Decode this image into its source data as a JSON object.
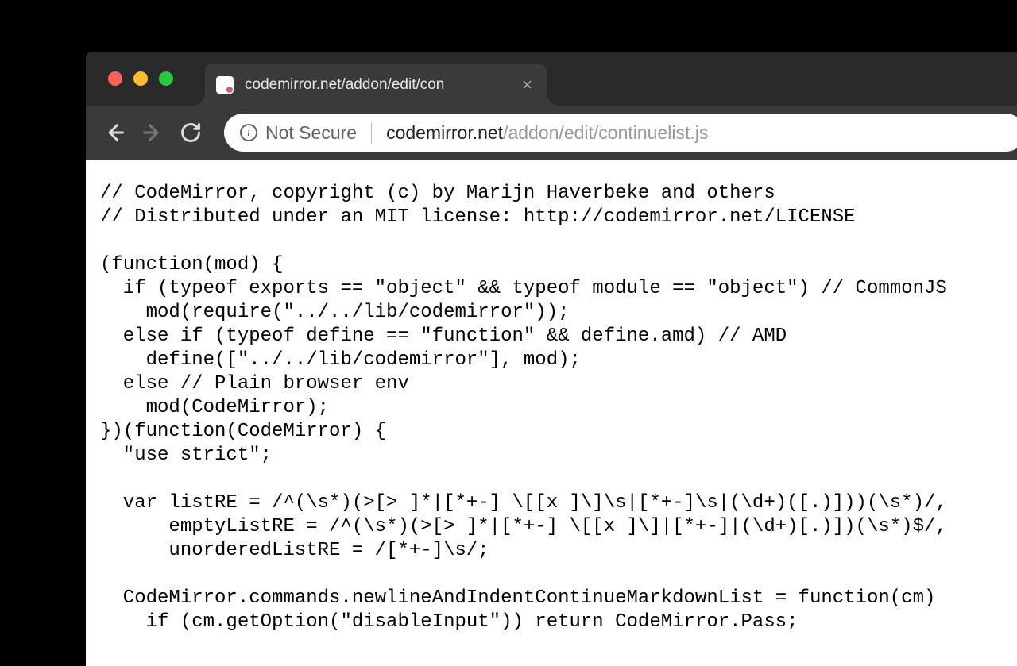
{
  "tab": {
    "title": "codemirror.net/addon/edit/con"
  },
  "addressbar": {
    "security_label": "Not Secure",
    "url_host": "codemirror.net",
    "url_path": "/addon/edit/continuelist.js"
  },
  "code": {
    "lines": [
      "// CodeMirror, copyright (c) by Marijn Haverbeke and others",
      "// Distributed under an MIT license: http://codemirror.net/LICENSE",
      "",
      "(function(mod) {",
      "  if (typeof exports == \"object\" && typeof module == \"object\") // CommonJS",
      "    mod(require(\"../../lib/codemirror\"));",
      "  else if (typeof define == \"function\" && define.amd) // AMD",
      "    define([\"../../lib/codemirror\"], mod);",
      "  else // Plain browser env",
      "    mod(CodeMirror);",
      "})(function(CodeMirror) {",
      "  \"use strict\";",
      "",
      "  var listRE = /^(\\s*)(>[> ]*|[*+-] \\[[x ]\\]\\s|[*+-]\\s|(\\d+)([.)]))(\\s*)/,",
      "      emptyListRE = /^(\\s*)(>[> ]*|[*+-] \\[[x ]\\]|[*+-]|(\\d+)[.)])(\\s*)$/,",
      "      unorderedListRE = /[*+-]\\s/;",
      "",
      "  CodeMirror.commands.newlineAndIndentContinueMarkdownList = function(cm) ",
      "    if (cm.getOption(\"disableInput\")) return CodeMirror.Pass;"
    ]
  }
}
